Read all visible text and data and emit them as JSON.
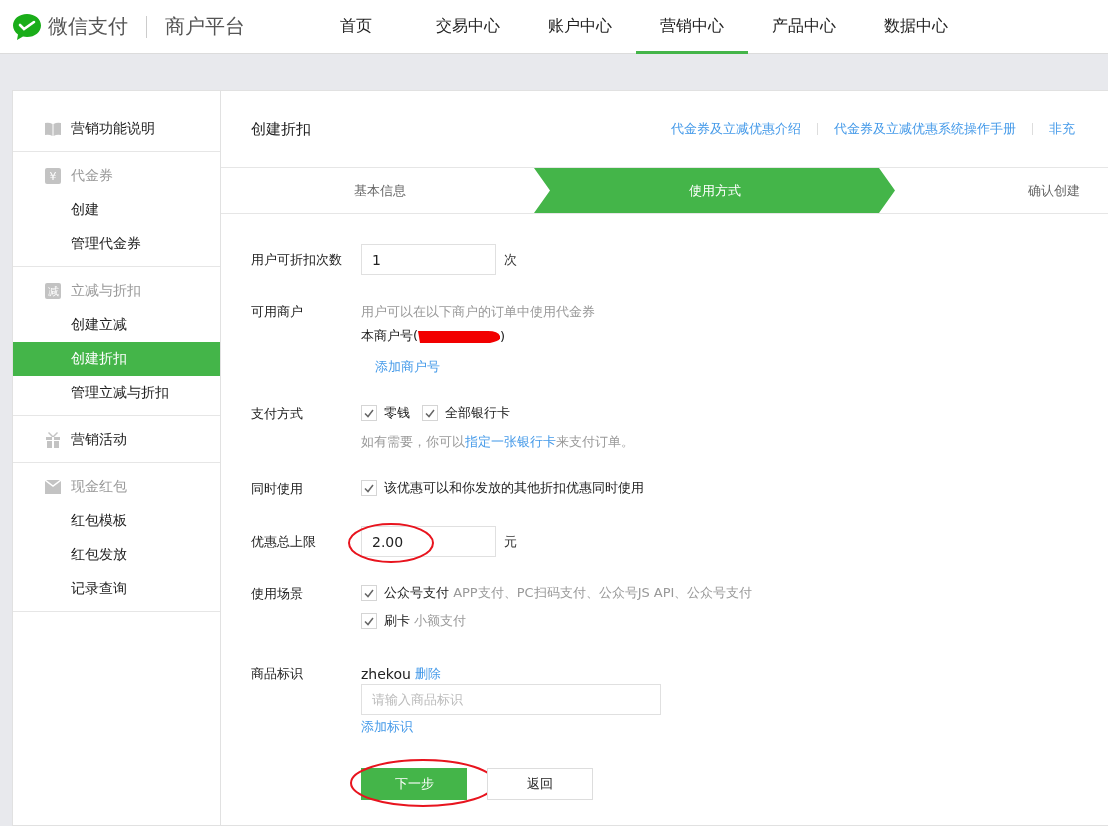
{
  "logo": {
    "brand": "微信支付",
    "product": "商户平台"
  },
  "nav": [
    {
      "label": "首页",
      "selected": false
    },
    {
      "label": "交易中心",
      "selected": false
    },
    {
      "label": "账户中心",
      "selected": false
    },
    {
      "label": "营销中心",
      "selected": true
    },
    {
      "label": "产品中心",
      "selected": false
    },
    {
      "label": "数据中心",
      "selected": false
    }
  ],
  "sidebar": {
    "sections": [
      {
        "kind": "link",
        "title": "营销功能说明"
      },
      {
        "kind": "group",
        "title": "代金券",
        "icon_text": "¥",
        "items": [
          {
            "label": "创建",
            "selected": false
          },
          {
            "label": "管理代金券",
            "selected": false
          }
        ]
      },
      {
        "kind": "group",
        "title": "立减与折扣",
        "icon_text": "减",
        "items": [
          {
            "label": "创建立减",
            "selected": false
          },
          {
            "label": "创建折扣",
            "selected": true
          },
          {
            "label": "管理立减与折扣",
            "selected": false
          }
        ]
      },
      {
        "kind": "link",
        "title": "营销活动"
      },
      {
        "kind": "group",
        "title": "现金红包",
        "items": [
          {
            "label": "红包模板",
            "selected": false
          },
          {
            "label": "红包发放",
            "selected": false
          },
          {
            "label": "记录查询",
            "selected": false
          }
        ]
      }
    ]
  },
  "page": {
    "title": "创建折扣",
    "help_links": [
      "代金券及立减优惠介绍",
      "代金券及立减优惠系统操作手册",
      "非充"
    ]
  },
  "steps": [
    {
      "label": "基本信息",
      "selected": false
    },
    {
      "label": "使用方式",
      "selected": true
    },
    {
      "label": "确认创建",
      "selected": false
    }
  ],
  "form": [
    {
      "kind": "number",
      "label": "用户可折扣次数",
      "value": "1",
      "unit": "次",
      "circled": false
    },
    {
      "kind": "merchants",
      "label": "可用商户",
      "hint": "用户可以在以下商户的订单中使用代金券",
      "merchant_prefix": "本商户号(",
      "merchant_suffix": ")",
      "redacted": true,
      "add_link": "添加商户号"
    },
    {
      "kind": "checks",
      "label": "支付方式",
      "options": [
        {
          "label": "零钱",
          "checked": true
        },
        {
          "label": "全部银行卡",
          "checked": true
        }
      ],
      "note_before": "如有需要，你可以",
      "note_link": "指定一张银行卡",
      "note_after": "来支付订单。"
    },
    {
      "kind": "checks",
      "label": "同时使用",
      "options": [
        {
          "label": "该优惠可以和你发放的其他折扣优惠同时使用",
          "checked": true
        }
      ]
    },
    {
      "kind": "number",
      "label": "优惠总上限",
      "value": "2.00",
      "unit": "元",
      "circled": true
    },
    {
      "kind": "checks",
      "label": "使用场景",
      "options": [
        {
          "label": "公众号支付",
          "detail": "APP支付、PC扫码支付、公众号JS API、公众号支付",
          "checked": true
        },
        {
          "label": "刷卡",
          "detail": "小额支付",
          "checked": true
        }
      ]
    },
    {
      "kind": "tags",
      "label": "商品标识",
      "tag": "zhekou",
      "delete_link": "删除",
      "placeholder": "请输入商品标识",
      "add_link": "添加标识"
    }
  ],
  "buttons": [
    {
      "kind": "primary",
      "label": "下一步",
      "circled": true
    },
    {
      "kind": "secondary",
      "label": "返回",
      "circled": false
    }
  ]
}
